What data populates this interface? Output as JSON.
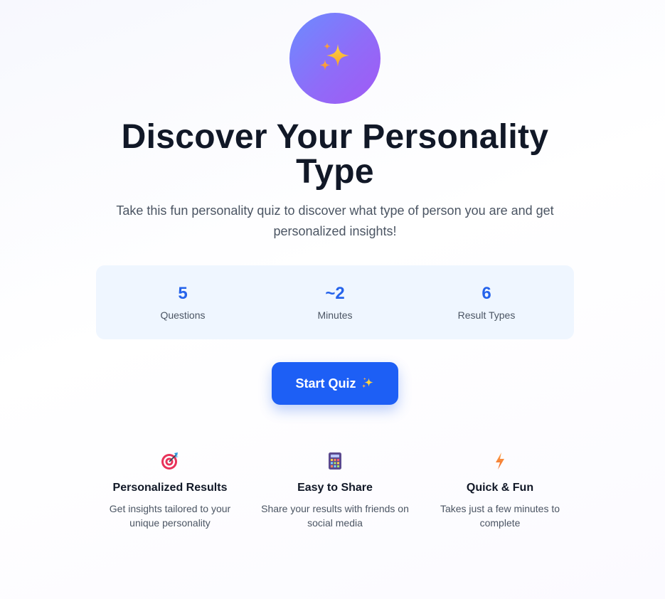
{
  "hero": {
    "icon": "sparkles-icon",
    "title": "Discover Your Personality Type",
    "subtitle": "Take this fun personality quiz to discover what type of person you are and get personalized insights!"
  },
  "stats": [
    {
      "value": "5",
      "label": "Questions"
    },
    {
      "value": "~2",
      "label": "Minutes"
    },
    {
      "value": "6",
      "label": "Result Types"
    }
  ],
  "start_button": {
    "label": "Start Quiz",
    "icon": "sparkles-icon"
  },
  "features": [
    {
      "icon": "target-icon",
      "title": "Personalized Results",
      "desc": "Get insights tailored to your unique personality"
    },
    {
      "icon": "calculator-icon",
      "title": "Easy to Share",
      "desc": "Share your results with friends on social media"
    },
    {
      "icon": "lightning-icon",
      "title": "Quick & Fun",
      "desc": "Takes just a few minutes to complete"
    }
  ],
  "colors": {
    "accent": "#1d5ff5",
    "stat_value": "#2563eb",
    "stats_bg": "#eff6ff",
    "hero_gradient_start": "#6b8cff",
    "hero_gradient_end": "#a259f4"
  }
}
